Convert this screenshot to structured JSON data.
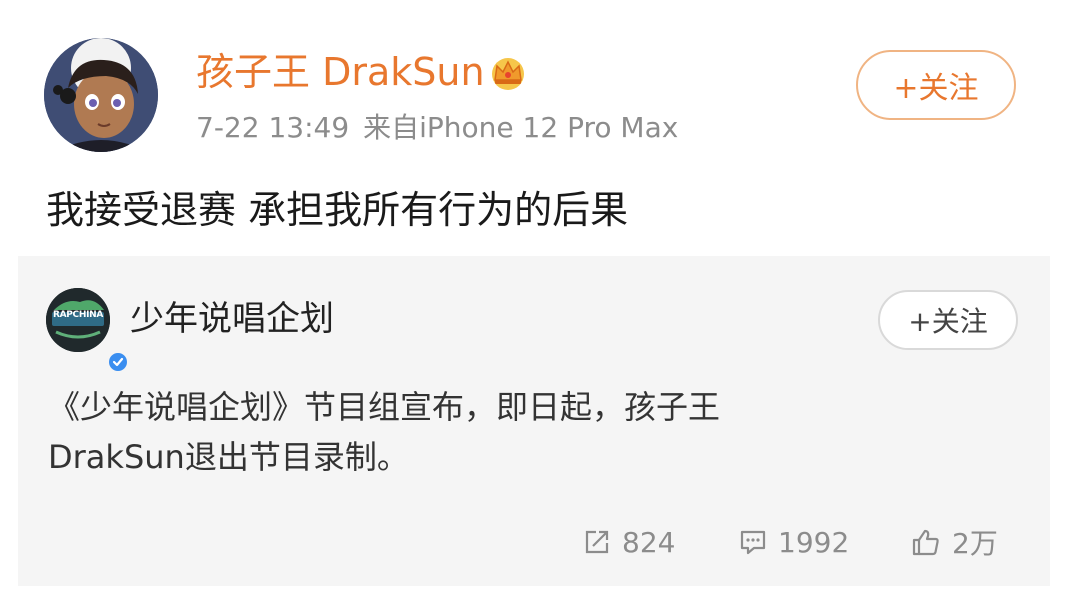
{
  "post": {
    "author": "孩子王 DrakSun",
    "date": "7-22 13:49",
    "source": "来自iPhone 12 Pro Max",
    "follow_label": "+关注",
    "text": "我接受退赛 承担我所有行为的后果"
  },
  "retweet": {
    "author": "少年说唱企划",
    "logo_text": "RAPCHINA",
    "follow_label": "+关注",
    "text_lines": [
      "《少年说唱企划》节目组宣布，即日起，孩子王",
      "DrakSun退出节目录制。"
    ],
    "actions": {
      "forward": "824",
      "comment": "1992",
      "like": "2万"
    }
  },
  "colors": {
    "accent": "#e8772e",
    "card_bg": "#f5f5f5",
    "meta_gray": "#8c8c8c",
    "verified_blue": "#3a8ef0"
  },
  "icons": [
    "crown-icon",
    "verified-icon",
    "forward-icon",
    "comment-icon",
    "like-icon"
  ]
}
